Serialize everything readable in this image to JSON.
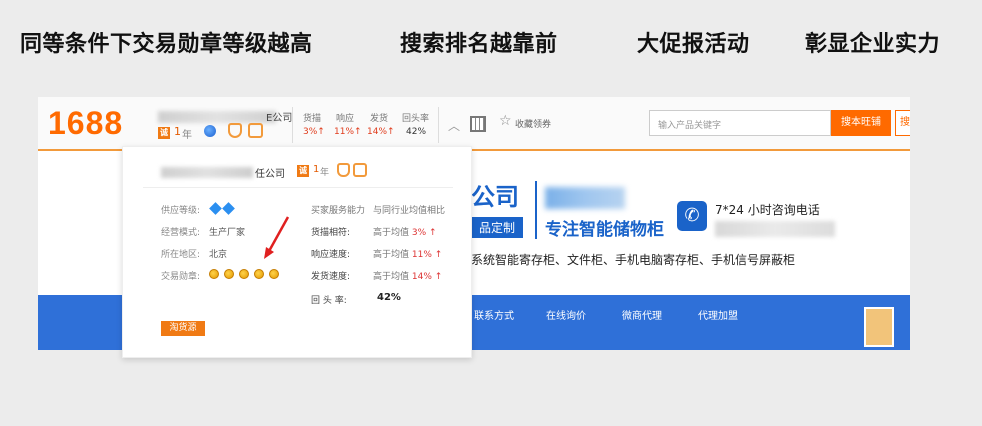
{
  "headline": {
    "part1": "同等条件下交易勋章等级越高",
    "part2": "搜索排名越靠前",
    "part3": "大促报活动",
    "part4": "彰显企业实力"
  },
  "header": {
    "logo": "1688",
    "company_suffix": "E公司",
    "year_icon": "诚",
    "year_num": "1",
    "year_unit": "年",
    "metrics": [
      {
        "label": "货描",
        "value": "3%↑"
      },
      {
        "label": "响应",
        "value": "11%↑"
      },
      {
        "label": "发货",
        "value": "14%↑"
      },
      {
        "label": "回头率",
        "value": "42%"
      }
    ],
    "favorite": "收藏领券",
    "search_placeholder": "输入产品关键字",
    "search_button": "搜本旺铺",
    "search_button2": "搜"
  },
  "background": {
    "brand_title": "公司",
    "brand_tag": "品定制",
    "slogan": "专注智能储物柜",
    "hotline": "7*24 小时咨询电话",
    "products": "系统智能寄存柜、文件柜、手机电脑寄存柜、手机信号屏蔽柜",
    "nav": [
      "联系方式",
      "在线询价",
      "微商代理",
      "代理加盟"
    ]
  },
  "popup": {
    "company_suffix": "任公司",
    "year_icon": "诚",
    "year_num": "1",
    "year_unit": "年",
    "supply_level_label": "供应等级:",
    "business_model_label": "经营模式:",
    "business_model_value": "生产厂家",
    "location_label": "所在地区:",
    "location_value": "北京",
    "medal_label": "交易勋章:",
    "service_head": "买家服务能力",
    "compare_head": "与同行业均值相比",
    "rows": [
      {
        "label": "货描相符:",
        "prefix": "高于均值",
        "value": "3%",
        "arrow": "↑"
      },
      {
        "label": "响应速度:",
        "prefix": "高于均值",
        "value": "11%",
        "arrow": "↑"
      },
      {
        "label": "发货速度:",
        "prefix": "高于均值",
        "value": "14%",
        "arrow": "↑"
      }
    ],
    "return_label": "回 头 率:",
    "return_value": "42%",
    "source_button": "淘货源"
  }
}
